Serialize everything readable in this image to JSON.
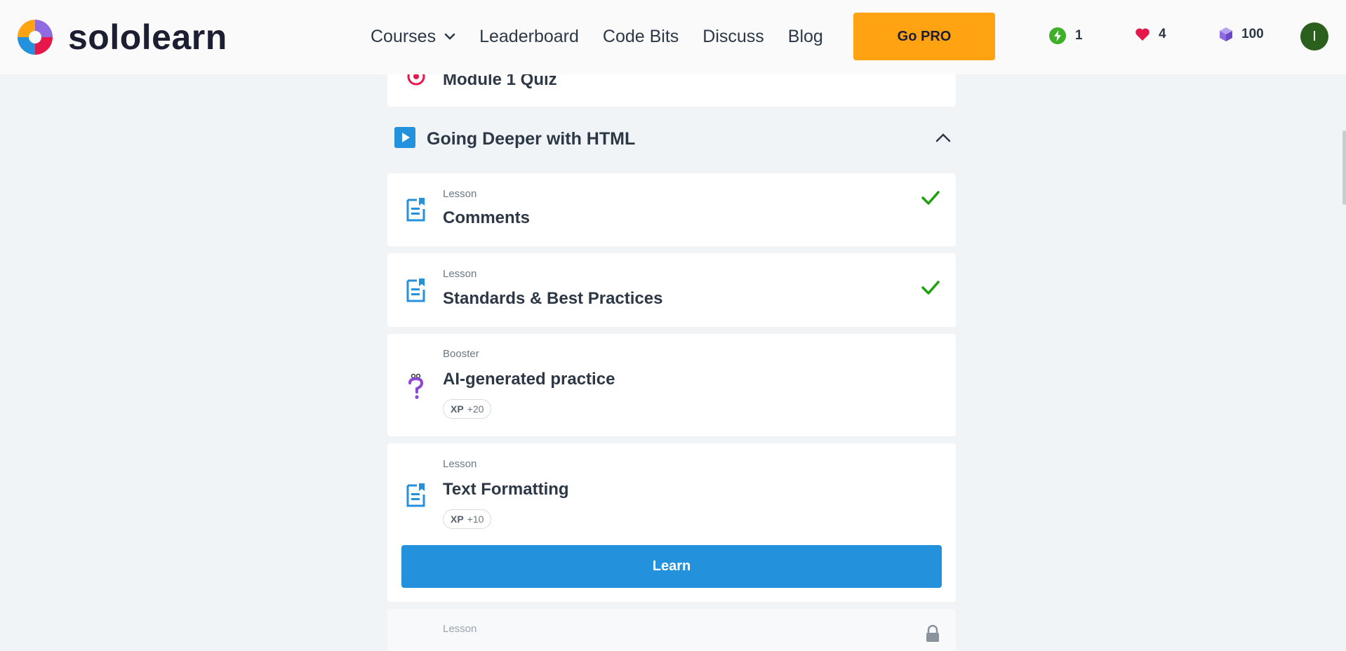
{
  "header": {
    "logo_text": "sololearn",
    "nav": {
      "courses": "Courses",
      "leaderboard": "Leaderboard",
      "code_bits": "Code Bits",
      "discuss": "Discuss",
      "blog": "Blog"
    },
    "go_pro": "Go PRO",
    "stats": {
      "streak": "1",
      "hearts": "4",
      "bits": "100"
    },
    "avatar_initial": "I"
  },
  "colors": {
    "accent": "#2491dd",
    "pro": "#ffa312",
    "check": "#1fa10e",
    "heart": "#e5174b",
    "bits": "#8e6be0"
  },
  "content": {
    "prev_item_title": "Module 1 Quiz",
    "section_title": "Going Deeper with HTML",
    "items": [
      {
        "type": "Lesson",
        "title": "Comments",
        "icon": "lesson-icon",
        "completed": true
      },
      {
        "type": "Lesson",
        "title": "Standards & Best Practices",
        "icon": "lesson-icon",
        "completed": true
      },
      {
        "type": "Booster",
        "title": "AI-generated practice",
        "icon": "question-icon",
        "xp_label": "XP",
        "xp_value": "+20"
      },
      {
        "type": "Lesson",
        "title": "Text Formatting",
        "icon": "lesson-icon",
        "xp_label": "XP",
        "xp_value": "+10",
        "action": "Learn"
      },
      {
        "type": "Lesson",
        "title": "",
        "icon": "lesson-icon",
        "locked": true
      }
    ]
  }
}
